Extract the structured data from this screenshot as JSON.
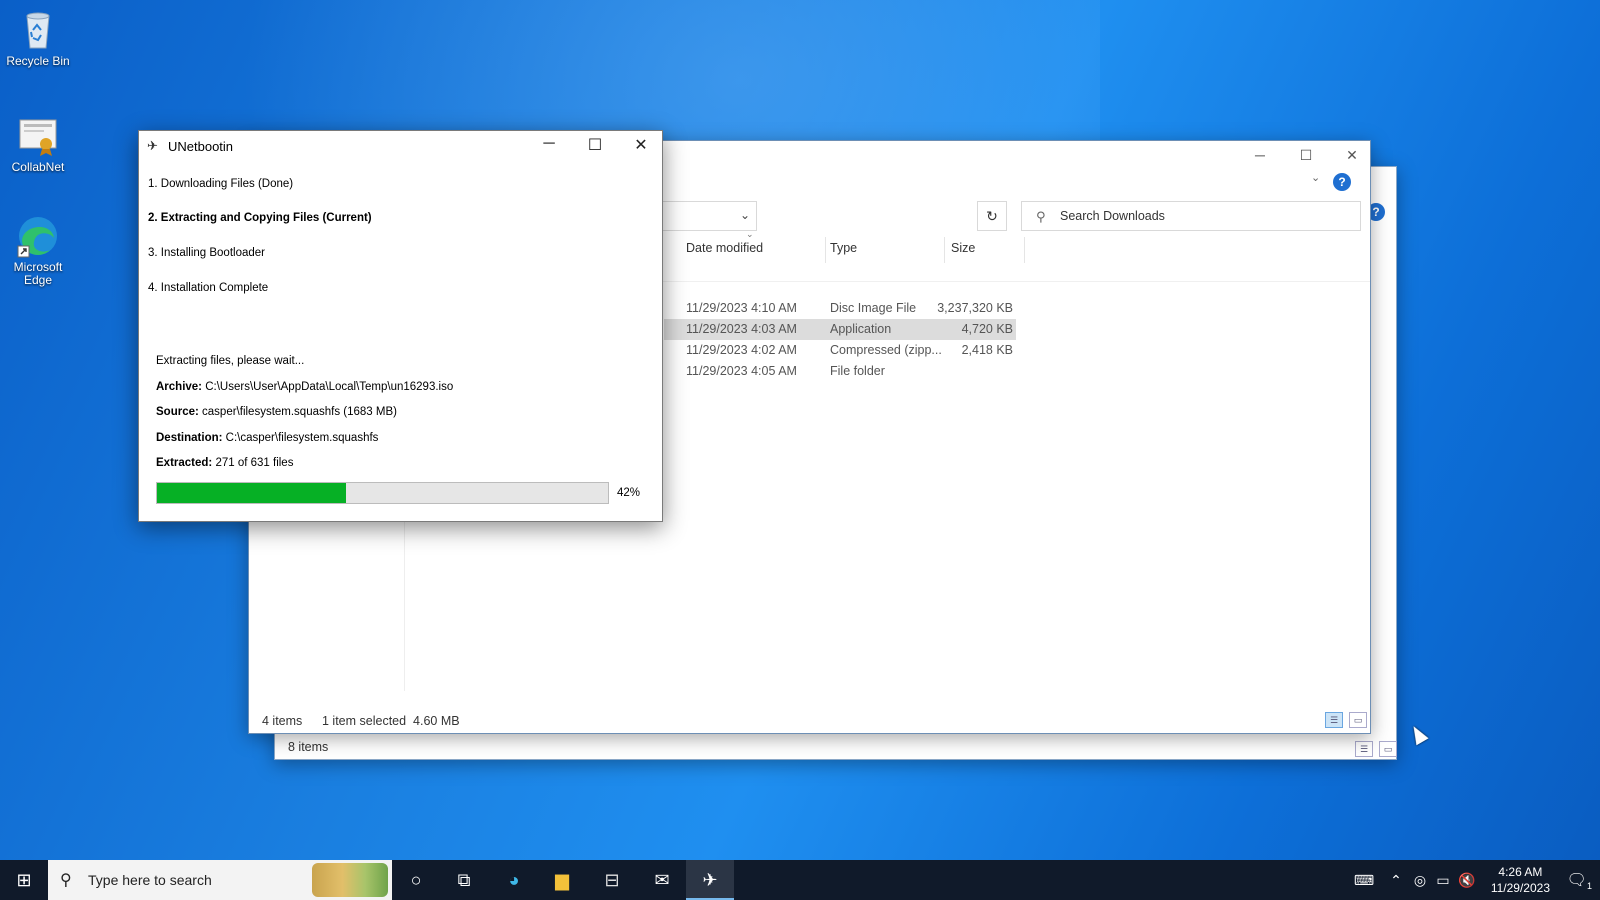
{
  "desktop": {
    "icons": [
      {
        "label": "Recycle Bin",
        "icon": "recycle-bin-icon"
      },
      {
        "label": "CollabNet",
        "icon": "certificate-icon"
      },
      {
        "label": "Microsoft Edge",
        "icon": "edge-icon"
      }
    ]
  },
  "explorer": {
    "search_placeholder": "Search Downloads",
    "columns": {
      "date": "Date modified",
      "type": "Type",
      "size": "Size"
    },
    "rows": [
      {
        "date": "11/29/2023 4:10 AM",
        "type": "Disc Image File",
        "size": "3,237,320 KB",
        "selected": false
      },
      {
        "date": "11/29/2023 4:03 AM",
        "type": "Application",
        "size": "4,720 KB",
        "selected": true
      },
      {
        "date": "11/29/2023 4:02 AM",
        "type": "Compressed (zipp...",
        "size": "2,418 KB",
        "selected": false
      },
      {
        "date": "11/29/2023 4:05 AM",
        "type": "File folder",
        "size": "",
        "selected": false
      }
    ],
    "status": {
      "count": "4 items",
      "selection": "1 item selected  4.60 MB"
    },
    "back_status": {
      "count": "8 items"
    }
  },
  "unetbootin": {
    "title": "UNetbootin",
    "steps": [
      {
        "label": "1. Downloading Files (Done)",
        "current": false
      },
      {
        "label": "2. Extracting and Copying Files (Current)",
        "current": true
      },
      {
        "label": "3. Installing Bootloader",
        "current": false
      },
      {
        "label": "4. Installation Complete",
        "current": false
      }
    ],
    "status_text": "Extracting files, please wait...",
    "archive_label": "Archive:",
    "archive_value": "C:\\Users\\User\\AppData\\Local\\Temp\\un16293.iso",
    "source_label": "Source:",
    "source_value": "casper\\filesystem.squashfs (1683 MB)",
    "destination_label": "Destination:",
    "destination_value": "C:\\casper\\filesystem.squashfs",
    "extracted_label": "Extracted:",
    "extracted_value": "271 of 631 files",
    "progress_percent": 42,
    "progress_label": "42%",
    "progress_color": "#06b025"
  },
  "taskbar": {
    "search_placeholder": "Type here to search",
    "pinned": [
      "cortana-icon",
      "task-view-icon",
      "edge-icon",
      "file-explorer-icon",
      "store-icon",
      "mail-icon",
      "unetbootin-icon"
    ],
    "time": "4:26 AM",
    "date": "11/29/2023",
    "notification_count": "1"
  }
}
